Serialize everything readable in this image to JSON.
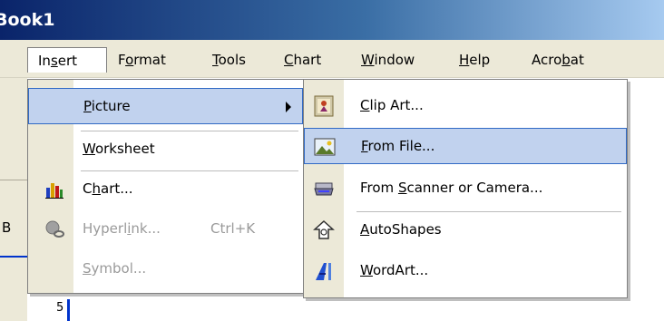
{
  "window": {
    "title": "Book1"
  },
  "menubar": {
    "items": [
      {
        "label": "Insert",
        "access": "s",
        "pre": "In",
        "post": "ert"
      },
      {
        "label": "Format",
        "access": "o",
        "pre": "F",
        "post": "rmat"
      },
      {
        "label": "Tools",
        "access": "T",
        "pre": "",
        "post": "ools"
      },
      {
        "label": "Chart",
        "access": "C",
        "pre": "",
        "post": "hart"
      },
      {
        "label": "Window",
        "access": "W",
        "pre": "",
        "post": "indow"
      },
      {
        "label": "Help",
        "access": "H",
        "pre": "",
        "post": "elp"
      },
      {
        "label": "Acrobat",
        "access": "b",
        "pre": "Acro",
        "post": "at"
      }
    ]
  },
  "insert_menu": {
    "items": [
      {
        "label": "Picture",
        "access": "P",
        "pre": "",
        "post": "icture",
        "state": "highlighted",
        "has_submenu": true,
        "icon": ""
      },
      {
        "label": "Worksheet",
        "access": "W",
        "pre": "",
        "post": "orksheet",
        "state": "enabled",
        "icon": ""
      },
      {
        "label": "Chart...",
        "access": "h",
        "pre": "C",
        "post": "art...",
        "state": "enabled",
        "icon": "chart-icon"
      },
      {
        "label": "Hyperlink...",
        "access": "i",
        "pre": "Hyperl",
        "post": "nk...",
        "shortcut": "Ctrl+K",
        "state": "disabled",
        "icon": "hyperlink-icon"
      },
      {
        "label": "Symbol...",
        "access": "S",
        "pre": "",
        "post": "ymbol...",
        "state": "disabled",
        "icon": ""
      }
    ]
  },
  "picture_submenu": {
    "items": [
      {
        "label": "Clip Art...",
        "access": "C",
        "pre": "",
        "post": "lip Art...",
        "state": "enabled",
        "icon": "clip-art-icon"
      },
      {
        "label": "From File...",
        "access": "F",
        "pre": "",
        "post": "rom File...",
        "state": "highlighted",
        "icon": "from-file-icon"
      },
      {
        "label": "From Scanner or Camera...",
        "access": "S",
        "pre": "From ",
        "post": "canner or Camera...",
        "state": "enabled",
        "icon": "scanner-icon"
      },
      {
        "label": "AutoShapes",
        "access": "A",
        "pre": "",
        "post": "utoShapes",
        "state": "enabled",
        "icon": "autoshapes-icon"
      },
      {
        "label": "WordArt...",
        "access": "W",
        "pre": "",
        "post": "ordArt...",
        "state": "enabled",
        "icon": "wordart-icon"
      }
    ]
  },
  "background": {
    "row_header": "5",
    "col_header": "B"
  },
  "colors": {
    "highlight": "#c1d2ee",
    "highlight_border": "#316ac5",
    "menu_gutter": "#ece9d8",
    "title_bar": "#0a246a"
  }
}
